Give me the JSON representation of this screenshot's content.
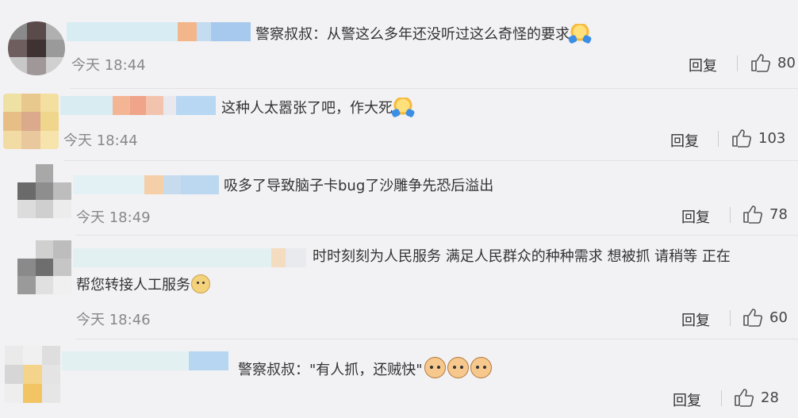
{
  "comments": [
    {
      "text_parts": [
        "警察叔叔：从警这么多年还没听过这么奇怪的要求"
      ],
      "emoji": "blush-emoji",
      "time": "今天 18:44",
      "reply_label": "回复",
      "likes": "80"
    },
    {
      "text_parts": [
        "这种人太嚣张了吧，作大死"
      ],
      "emoji": "blush-emoji",
      "time": "今天 18:44",
      "reply_label": "回复",
      "likes": "103"
    },
    {
      "text_parts": [
        "吸多了导致脑子卡bug了沙雕争先恐后溢出"
      ],
      "time": "今天 18:49",
      "reply_label": "回复",
      "likes": "78"
    },
    {
      "text_parts": [
        "时时刻刻为人民服务 满足人民群众的种种需求 想被抓 请稍等 正在",
        "帮您转接人工服务"
      ],
      "emoji": "doge-emoji",
      "time": "今天 18:46",
      "reply_label": "回复",
      "likes": "60"
    },
    {
      "text_parts": [
        "警察叔叔：\"有人抓，还贼快\""
      ],
      "emoji": "cat-emoji",
      "reply_label": "回复",
      "likes": "28"
    }
  ],
  "colors": {
    "background": "#f2f2f4",
    "text": "#333333",
    "time": "#888888"
  }
}
